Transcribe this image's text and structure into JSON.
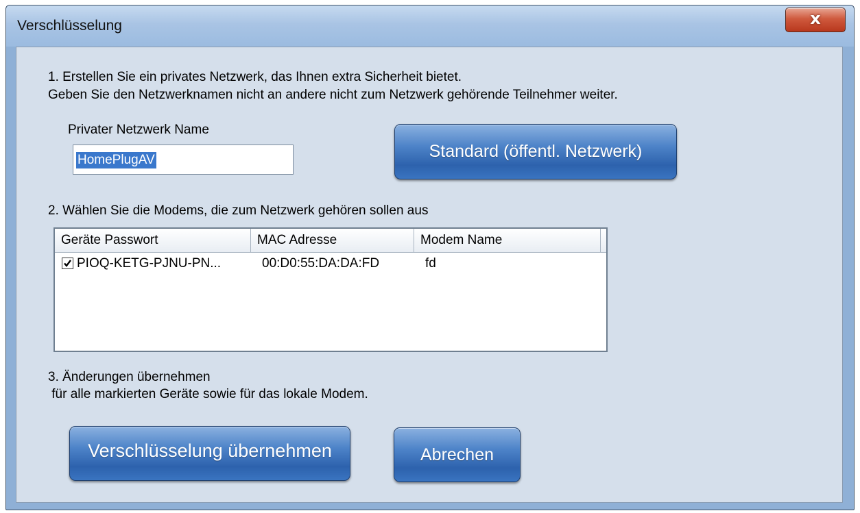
{
  "window": {
    "title": "Verschlüsselung",
    "close_label": "x"
  },
  "step1": {
    "line1": "1. Erstellen Sie ein privates Netzwerk, das Ihnen extra Sicherheit bietet.",
    "line2": "Geben Sie den Netzwerknamen nicht an andere nicht zum Netzwerk gehörende Teilnehmer weiter.",
    "name_label": "Privater Netzwerk Name",
    "name_value": "HomePlugAV",
    "standard_button": "Standard (öffentl. Netzwerk)"
  },
  "step2": {
    "label": "2. Wählen Sie die Modems, die zum Netzwerk gehören sollen aus",
    "columns": [
      "Geräte Passwort",
      "MAC Adresse",
      "Modem Name"
    ],
    "rows": [
      {
        "checked": true,
        "password": "PIOQ-KETG-PJNU-PN...",
        "mac": "00:D0:55:DA:DA:FD",
        "name": "fd"
      }
    ]
  },
  "step3": {
    "line1": "3. Änderungen übernehmen",
    "line2": " für alle markierten Geräte sowie für das lokale Modem.",
    "apply_button": "Verschlüsselung übernehmen",
    "cancel_button": "Abrechen"
  }
}
